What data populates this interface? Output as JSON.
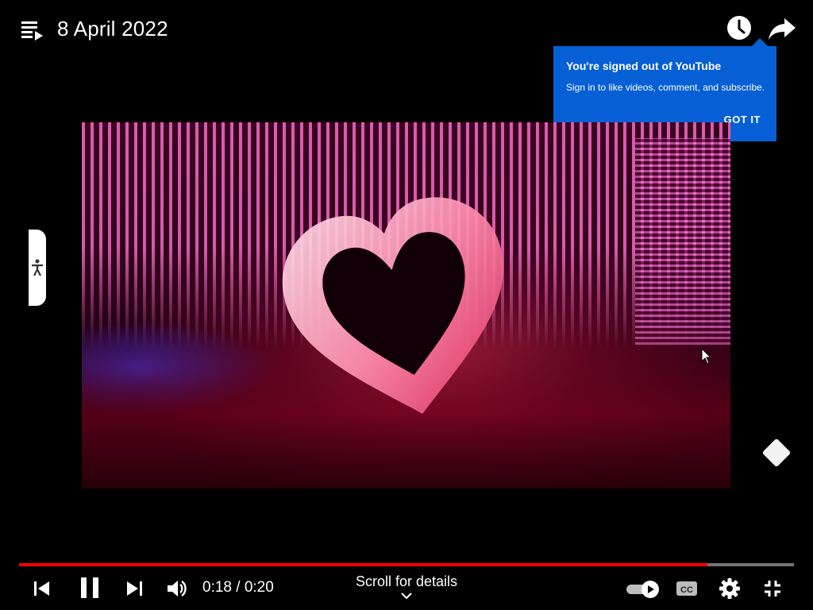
{
  "header": {
    "title": "8 April 2022",
    "playlist_icon": "playlist-play-icon",
    "watch_later_icon": "clock-icon",
    "share_icon": "share-arrow-icon"
  },
  "tooltip": {
    "title": "You're signed out of YouTube",
    "text": "Sign in to like videos, comment, and subscribe.",
    "button_label": "GOT IT",
    "background": "#065fd4"
  },
  "player": {
    "time_display": "0:18 / 0:20",
    "progress_fraction": 0.888,
    "scroll_label": "Scroll for details",
    "progress_color": "#ff0000"
  },
  "controls": {
    "prev_icon": "skip-previous-icon",
    "pause_icon": "pause-icon",
    "next_icon": "skip-next-icon",
    "volume_icon": "volume-icon",
    "autoplay_icon": "autoplay-toggle-icon",
    "cc_icon": "closed-captions-icon",
    "settings_icon": "gear-icon",
    "exit_fullscreen_icon": "exit-fullscreen-icon"
  },
  "side": {
    "accessibility_icon": "accessibility-icon",
    "diamond_icon": "diamond-icon"
  }
}
